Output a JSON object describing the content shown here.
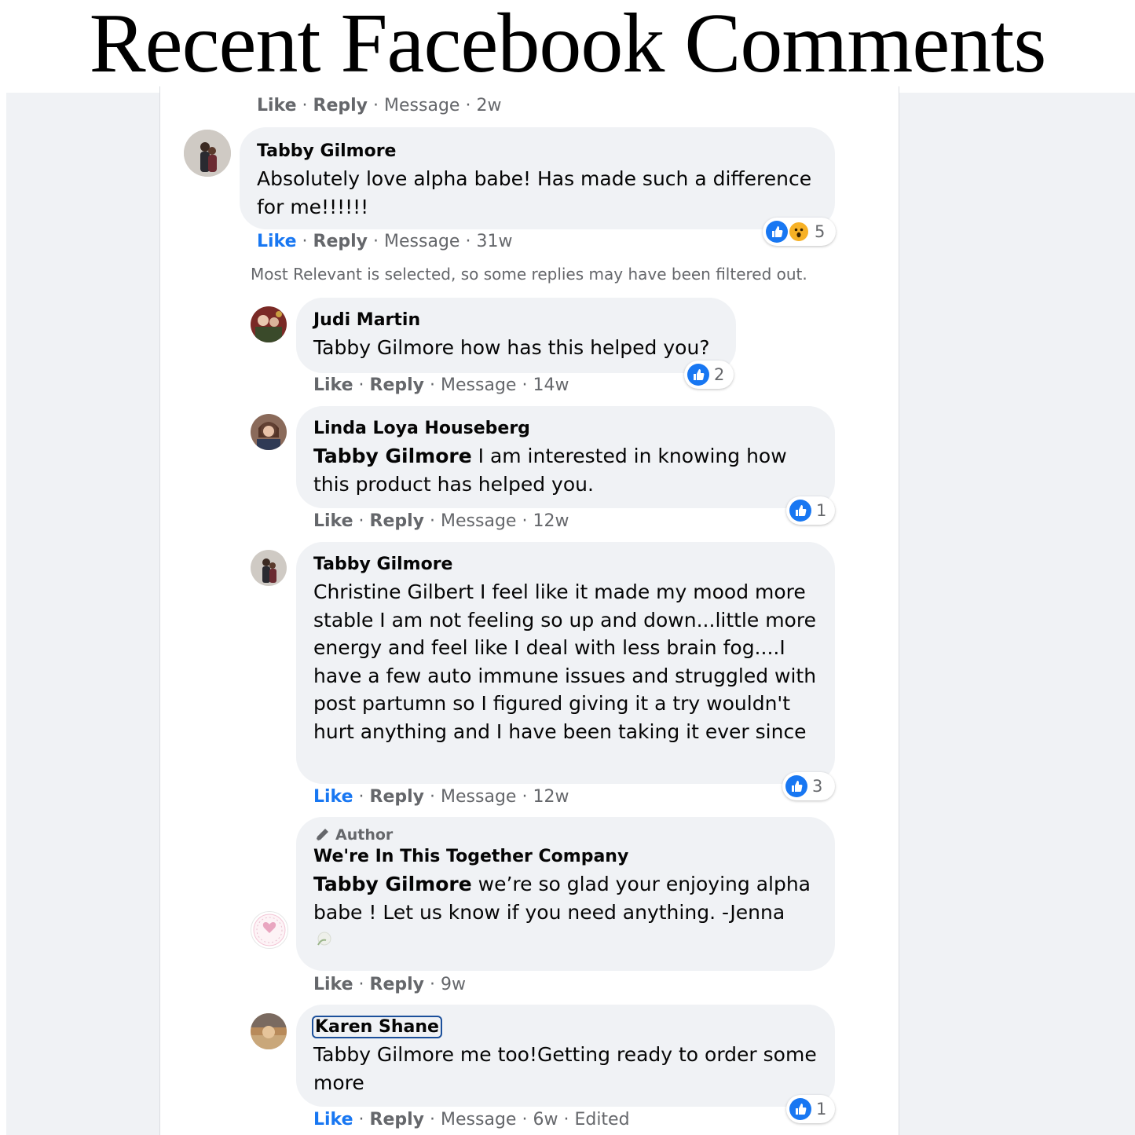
{
  "header": {
    "title": "Recent Facebook Comments"
  },
  "top_actions": {
    "like": "Like",
    "reply": "Reply",
    "message": "Message",
    "time": "2w"
  },
  "sep": "·",
  "comments": [
    {
      "name": "Tabby Gilmore",
      "text": "Absolutely love alpha babe! Has made such a difference for me!!!!!!",
      "actions": {
        "like": "Like",
        "reply": "Reply",
        "message": "Message",
        "time": "31w"
      },
      "reactions": {
        "icons": [
          "like-icon",
          "wow-icon"
        ],
        "count": "5"
      }
    }
  ],
  "notice": "Most Relevant is selected, so some replies may have been filtered out.",
  "replies": [
    {
      "name": "Judi Martin",
      "text": "Tabby Gilmore how has this helped you?",
      "actions": {
        "like": "Like",
        "reply": "Reply",
        "message": "Message",
        "time": "14w"
      },
      "reactions": {
        "icons": [
          "like-icon"
        ],
        "count": "2"
      }
    },
    {
      "name": "Linda Loya Houseberg",
      "mention": "Tabby Gilmore",
      "text": " I am interested in knowing how this product has helped you.",
      "actions": {
        "like": "Like",
        "reply": "Reply",
        "message": "Message",
        "time": "12w"
      },
      "reactions": {
        "icons": [
          "like-icon"
        ],
        "count": "1"
      }
    },
    {
      "name": "Tabby Gilmore",
      "text": "Christine Gilbert I feel like it made my mood more stable I am not feeling so up and down...little more energy and feel like I deal with less brain fog....I have a few auto immune issues and struggled with post partumn so I figured giving it a try wouldn't hurt anything and I have been taking it ever since",
      "actions": {
        "like": "Like",
        "reply": "Reply",
        "message": "Message",
        "time": "12w"
      },
      "reactions": {
        "icons": [
          "like-icon"
        ],
        "count": "3"
      }
    },
    {
      "badge": "Author",
      "name": "We're In This Together Company",
      "mention": "Tabby Gilmore",
      "text": " we’re so glad your enjoying alpha babe ! Let us know if you need anything. -Jenna",
      "actions": {
        "like": "Like",
        "reply": "Reply",
        "time": "9w"
      }
    },
    {
      "name": "Karen Shane",
      "text": "Tabby Gilmore me too!Getting ready to order some more",
      "actions": {
        "like": "Like",
        "reply": "Reply",
        "message": "Message",
        "time": "6w",
        "edited": "Edited"
      },
      "reactions": {
        "icons": [
          "like-icon"
        ],
        "count": "1"
      }
    }
  ],
  "colors": {
    "link_blue": "#1877f2",
    "meta_gray": "#65676b",
    "bubble": "#f0f2f5",
    "wow": "#f7b125"
  }
}
